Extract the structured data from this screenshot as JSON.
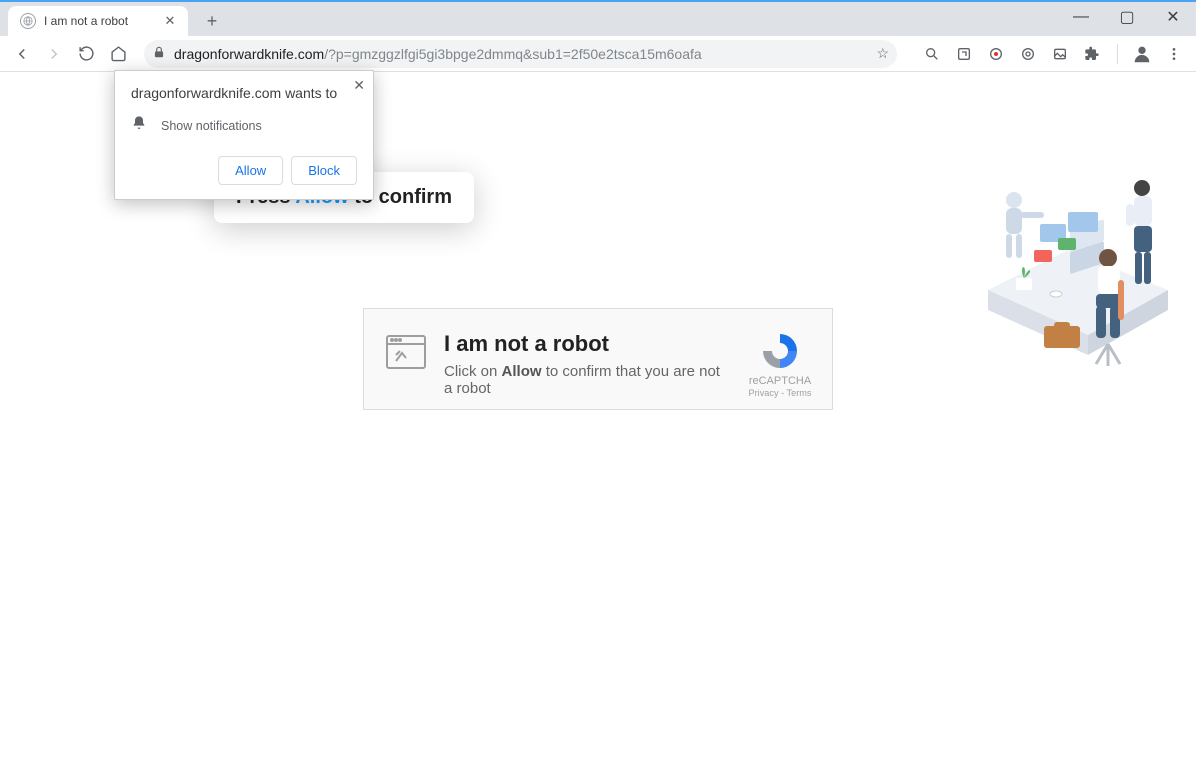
{
  "tab": {
    "title": "I am not a robot"
  },
  "window_controls": {
    "minimize": "—",
    "maximize": "▢",
    "close": "✕"
  },
  "toolbar": {
    "url_host": "dragonforwardknife.com",
    "url_path": "/?p=gmzggzlfgi5gi3bpge2dmmq&sub1=2f50e2tsca15m6oafa"
  },
  "notification_popup": {
    "site_wants": "dragonforwardknife.com wants to",
    "show_notifications": "Show notifications",
    "allow": "Allow",
    "block": "Block"
  },
  "callout": {
    "before": "Press ",
    "highlight": "Allow",
    "after": " to confirm"
  },
  "card": {
    "title": "I am not a robot",
    "text_before": "Click on ",
    "text_bold": "Allow",
    "text_after": " to confirm that you are not a robot"
  },
  "recaptcha": {
    "label": "reCAPTCHA",
    "privacy": "Privacy",
    "sep": " - ",
    "terms": "Terms"
  }
}
